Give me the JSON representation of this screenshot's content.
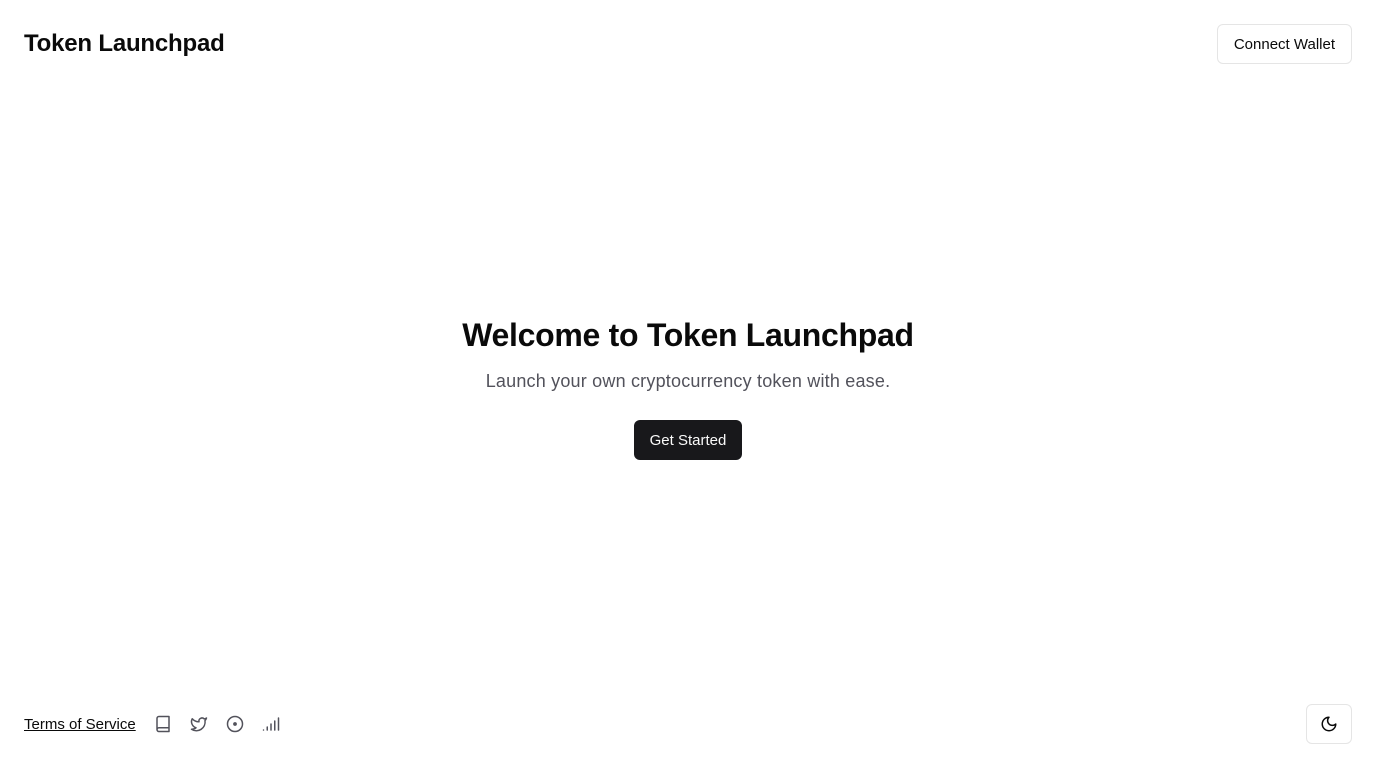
{
  "header": {
    "brand": "Token Launchpad",
    "connect_wallet_label": "Connect Wallet"
  },
  "hero": {
    "title": "Welcome to Token Launchpad",
    "subtitle": "Launch your own cryptocurrency token with ease.",
    "cta_label": "Get Started"
  },
  "footer": {
    "terms_label": "Terms of Service",
    "icons": [
      "book-icon",
      "twitter-icon",
      "circle-dot-icon",
      "signal-icon"
    ],
    "theme_toggle_icon": "moon-icon"
  },
  "colors": {
    "primary": "#18181b",
    "muted_text": "#52525b",
    "border": "#e5e5e5"
  }
}
